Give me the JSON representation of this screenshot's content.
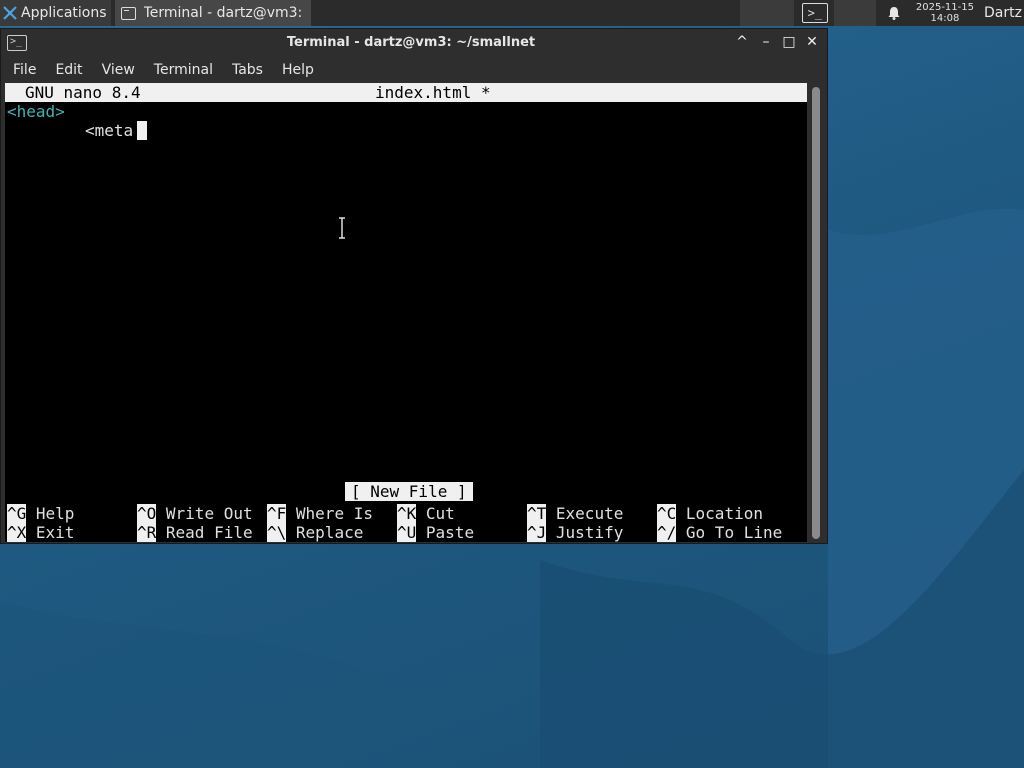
{
  "panel": {
    "applications_label": "Applications",
    "task_label": "Terminal - dartz@vm3: ...",
    "clock_date": "2025-11-15",
    "clock_time": "14:08",
    "user": "Dartz",
    "tray_terminal_glyph": ">_"
  },
  "window": {
    "title": "Terminal - dartz@vm3: ~/smallnet",
    "icon_glyph": ">_",
    "controls": {
      "up": "^",
      "minimize": "–",
      "maximize": "□",
      "close": "✕"
    }
  },
  "menu": [
    "File",
    "Edit",
    "View",
    "Terminal",
    "Tabs",
    "Help"
  ],
  "nano": {
    "version_label": "GNU nano 8.4",
    "filename_label": "index.html *",
    "lines": [
      "<head>",
      "<meta"
    ],
    "status": "[ New File ]",
    "shortcuts_row1": [
      {
        "key": "^G",
        "label": "Help"
      },
      {
        "key": "^O",
        "label": "Write Out"
      },
      {
        "key": "^F",
        "label": "Where Is"
      },
      {
        "key": "^K",
        "label": "Cut"
      },
      {
        "key": "^T",
        "label": "Execute"
      },
      {
        "key": "^C",
        "label": "Location"
      }
    ],
    "shortcuts_row2": [
      {
        "key": "^X",
        "label": "Exit"
      },
      {
        "key": "^R",
        "label": "Read File"
      },
      {
        "key": "^\\",
        "label": "Replace"
      },
      {
        "key": "^U",
        "label": "Paste"
      },
      {
        "key": "^J",
        "label": "Justify"
      },
      {
        "key": "^/",
        "label": "Go To Line"
      }
    ]
  },
  "colors": {
    "panel_bg": "#2b2b2b",
    "window_bg": "#2e2e2e",
    "terminal_bg": "#000000",
    "tag_color": "#3fb5b5",
    "wallpaper": "#1f5a84"
  },
  "icons": [
    "xfce-logo-icon",
    "terminal-icon",
    "bell-icon",
    "ibeam-cursor-icon"
  ]
}
